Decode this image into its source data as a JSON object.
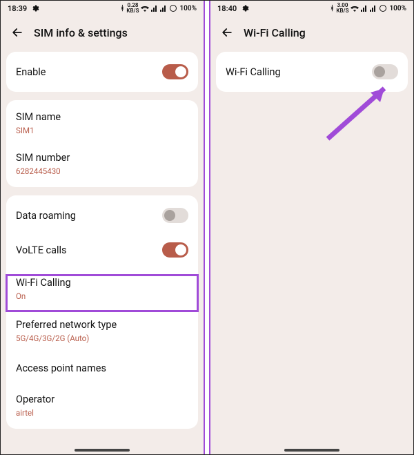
{
  "left": {
    "status": {
      "time": "18:39",
      "net": "0.28",
      "netUnit": "KB/S",
      "battery": "100%"
    },
    "header": {
      "title": "SIM info & settings"
    },
    "card1": {
      "enable": {
        "label": "Enable",
        "on": true
      }
    },
    "card2": {
      "simName": {
        "label": "SIM name",
        "value": "SIM1"
      },
      "simNumber": {
        "label": "SIM number",
        "value": "6282445430"
      }
    },
    "card3": {
      "dataRoaming": {
        "label": "Data roaming",
        "on": false
      },
      "volte": {
        "label": "VoLTE calls",
        "on": true
      },
      "wifiCalling": {
        "label": "Wi-Fi Calling",
        "value": "On"
      },
      "prefNet": {
        "label": "Preferred network type",
        "value": "5G/4G/3G/2G (Auto)"
      },
      "apn": {
        "label": "Access point names"
      },
      "operator": {
        "label": "Operator",
        "value": "airtel"
      }
    }
  },
  "right": {
    "status": {
      "time": "18:40",
      "net": "3.00",
      "netUnit": "KB/S",
      "battery": "100%"
    },
    "header": {
      "title": "Wi-Fi Calling"
    },
    "card1": {
      "wifiCalling": {
        "label": "Wi-Fi Calling",
        "on": false
      }
    }
  }
}
